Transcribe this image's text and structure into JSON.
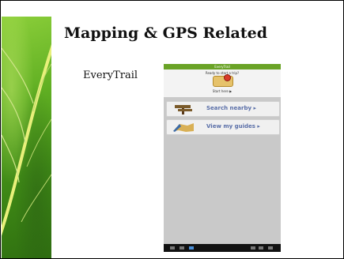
{
  "slide": {
    "title": "Mapping & GPS Related",
    "item_label": "EveryTrail"
  },
  "tablet": {
    "app_bar_title": "EveryTrail",
    "prompt": "Ready to start a trip?",
    "start_link": "Start here ▶",
    "buttons": [
      {
        "label": "Search nearby ▸",
        "icon": "signpost-icon"
      },
      {
        "label": "View my guides ▸",
        "icon": "map-icon"
      }
    ]
  },
  "colors": {
    "leaf_green": "#5fae22",
    "app_bar": "#6aa327",
    "button_text": "#5a6fa8"
  }
}
